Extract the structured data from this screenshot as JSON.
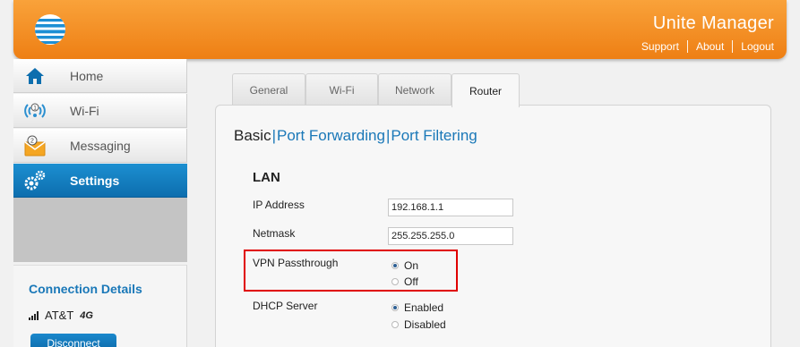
{
  "header": {
    "app_title": "Unite Manager",
    "links": {
      "support": "Support",
      "about": "About",
      "logout": "Logout"
    },
    "color_top": "#f9a23a",
    "color_bottom": "#ee7f14"
  },
  "sidebar": {
    "items": [
      {
        "label": "Home",
        "icon": "home-icon",
        "active": false
      },
      {
        "label": "Wi-Fi",
        "icon": "wifi-icon",
        "badge": "1",
        "active": false
      },
      {
        "label": "Messaging",
        "icon": "envelope-icon",
        "badge": "2",
        "active": false
      },
      {
        "label": "Settings",
        "icon": "gear-icon",
        "active": true
      }
    ],
    "active_color": "#1180c2"
  },
  "connection": {
    "title": "Connection Details",
    "carrier": "AT&T",
    "network_badge": "4G",
    "disconnect_label": "Disconnect"
  },
  "tabs": [
    {
      "label": "General",
      "active": false
    },
    {
      "label": "Wi-Fi",
      "active": false
    },
    {
      "label": "Network",
      "active": false
    },
    {
      "label": "Router",
      "active": true
    }
  ],
  "subnav": {
    "active": "Basic",
    "links": [
      "Port Forwarding",
      "Port Filtering"
    ],
    "separator": "|"
  },
  "lan": {
    "title": "LAN",
    "ip_address": {
      "label": "IP Address",
      "value": "192.168.1.1"
    },
    "netmask": {
      "label": "Netmask",
      "value": "255.255.255.0"
    },
    "vpn_passthrough": {
      "label": "VPN Passthrough",
      "options": [
        "On",
        "Off"
      ],
      "selected": "On"
    },
    "dhcp_server": {
      "label": "DHCP Server",
      "options": [
        "Enabled",
        "Disabled"
      ],
      "selected": "Enabled"
    }
  },
  "highlight_color": "#e00000"
}
